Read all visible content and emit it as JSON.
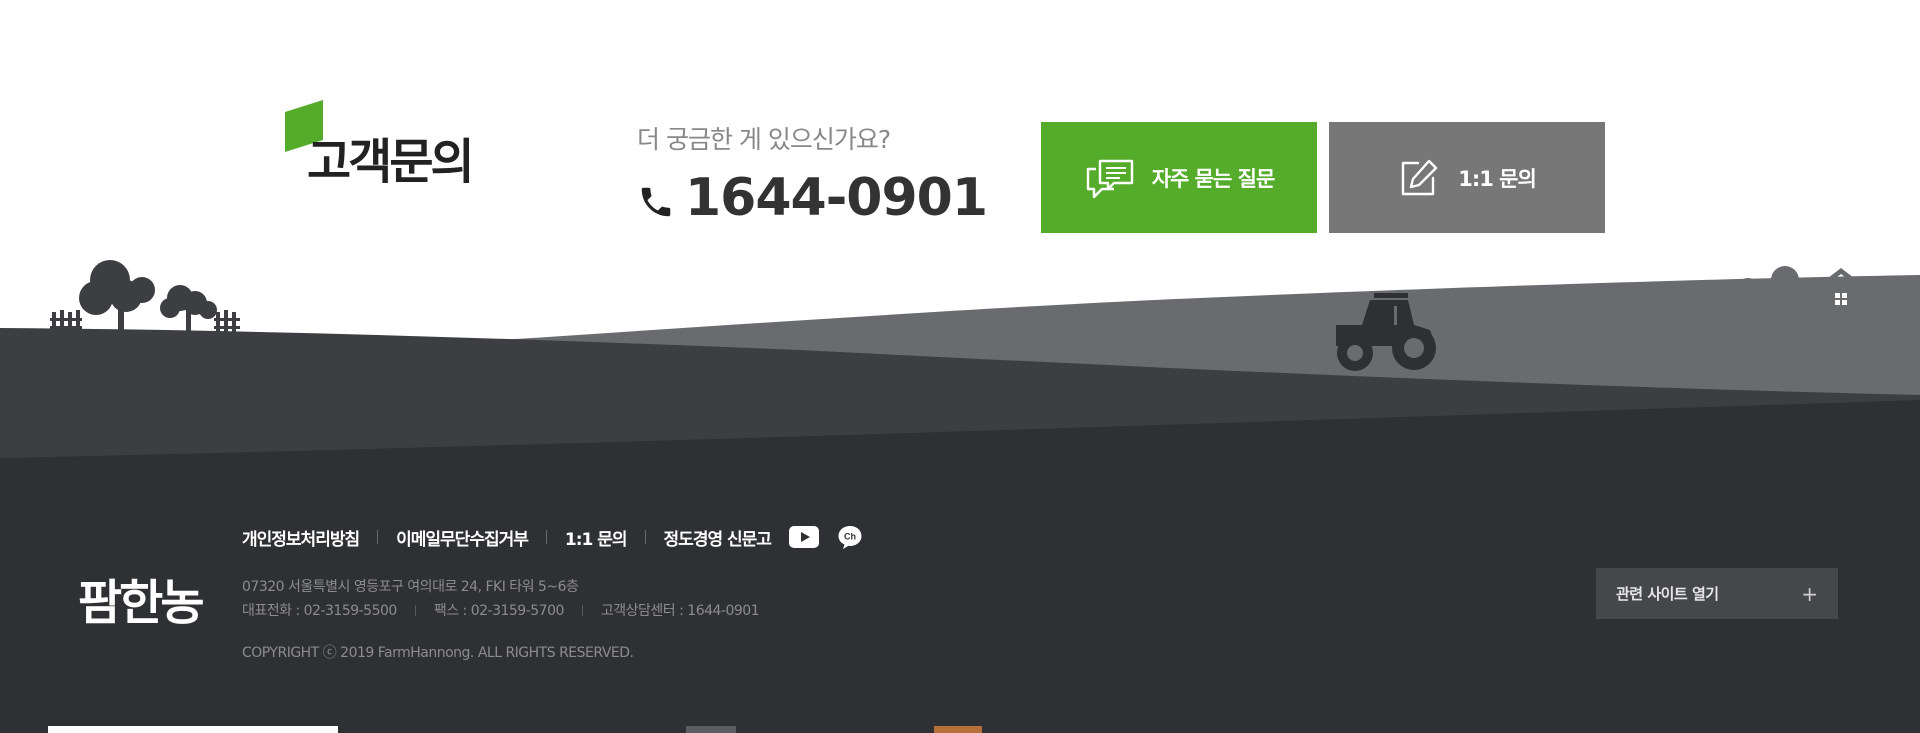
{
  "contact": {
    "title": "고객문의",
    "question": "더 궁금한 게 있으신가요?",
    "phone_number": "1644-0901",
    "faq_button": "자주 묻는 질문",
    "inquiry_button": "1:1 문의"
  },
  "footer": {
    "logo": "팜한농",
    "links": [
      "개인정보처리방침",
      "이메일무단수집거부",
      "1:1 문의",
      "정도경영 신문고"
    ],
    "address": "07320 서울특별시 영등포구 여의대로 24, FKI 타워 5~6층",
    "phones": [
      "대표전화 : 02-3159-5500",
      "팩스 : 02-3159-5700",
      "고객상담센터 : 1644-0901"
    ],
    "copyright": "COPYRIGHT ⓒ 2019 FarmHannong. ALL RIGHTS RESERVED.",
    "related_sites": "관련 사이트 열기",
    "related_icon": "plus-icon"
  },
  "colors": {
    "accent_green": "#55ab2a",
    "button_gray": "#777777",
    "footer_bg": "#2f3033",
    "hill_dark": "#3d3e41",
    "hill_light": "#6a6b6e"
  }
}
